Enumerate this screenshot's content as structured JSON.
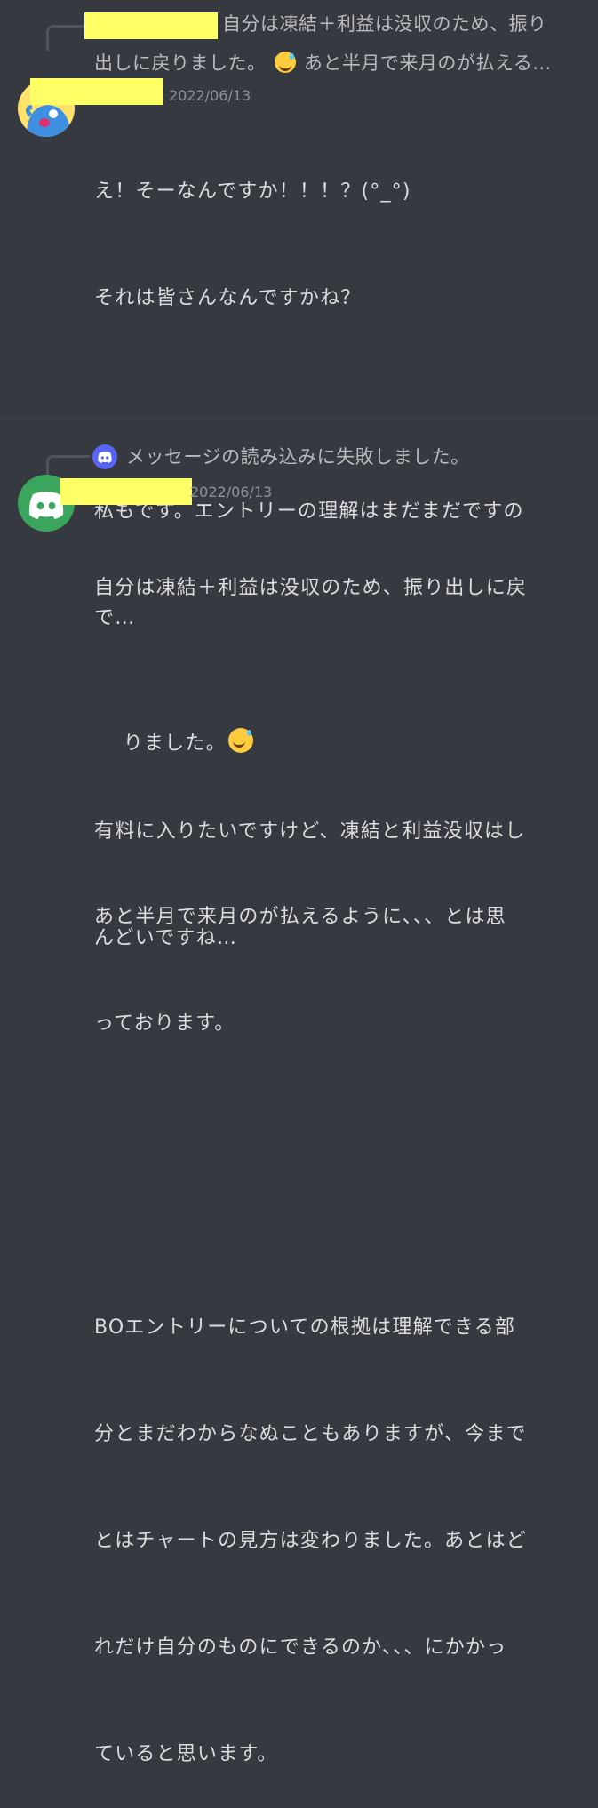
{
  "message1": {
    "reply_preview_line1": "自分は凍結＋利益は没収のため、振り",
    "reply_preview_line2": "出しに戻りました。",
    "reply_preview_line2_tail": "あと半月で来月のが払える...",
    "date": "2022/06/13",
    "lines": [
      "え！そーなんですか！！！？(°_°)",
      "それは皆さんなんですかね？",
      "",
      "私もです。エントリーの理解はまだまだですの",
      "で…",
      "",
      "有料に入りたいですけど、凍結と利益没収はし",
      "んどいですね…"
    ]
  },
  "message2": {
    "reply_preview": "メッセージの読み込みに失敗しました。",
    "date": "2022/06/13",
    "line1": "自分は凍結＋利益は没収のため、振り出しに戻",
    "line2": "りました。",
    "lines_rest": [
      "",
      "あと半月で来月のが払えるように、、、とは思",
      "っております。",
      "",
      "",
      "BOエントリーについての根拠は理解できる部",
      "分とまだわからなぬこともありますが、今まで",
      "とはチャートの見方は変わりました。あとはど",
      "れだけ自分のものにできるのか、、、にかかっ",
      "ていると思います。"
    ]
  },
  "colors": {
    "background": "#36393f",
    "text": "#dcddde",
    "muted": "#b9bbbe",
    "redaction": "#ffff66",
    "discord_blurple": "#5865f2",
    "discord_green": "#3ba55d"
  }
}
